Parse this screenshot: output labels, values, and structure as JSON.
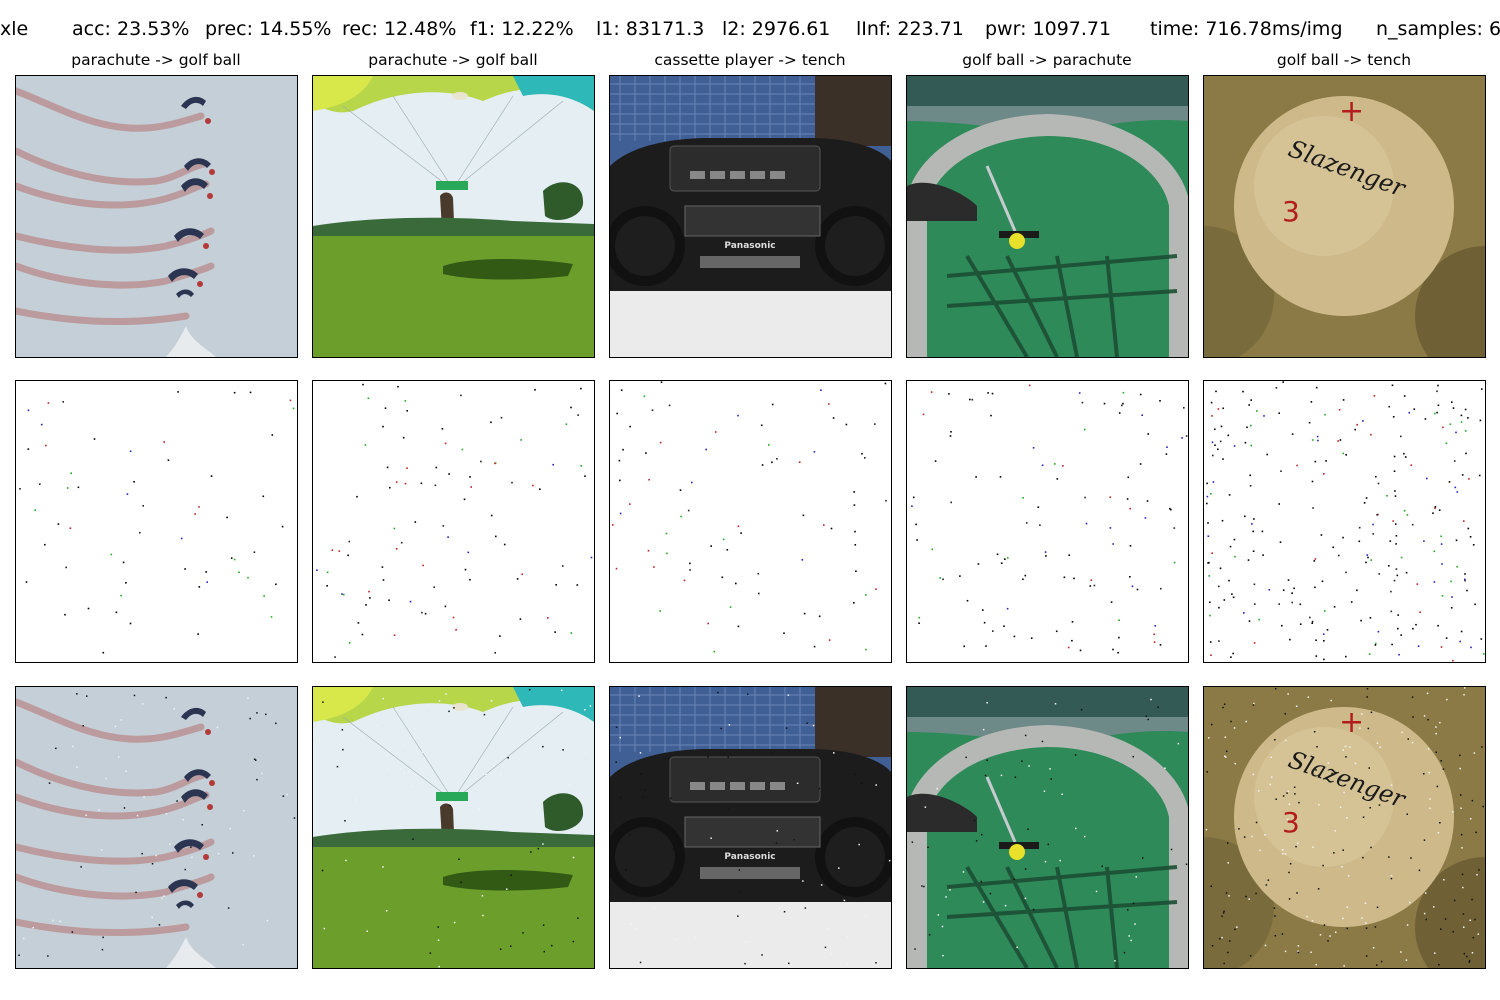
{
  "metrics": {
    "method": "xle",
    "acc": "acc: 23.53%",
    "prec": "prec: 14.55%",
    "rec": "rec: 12.48%",
    "f1": "f1: 12.22%",
    "l1": "l1: 83171.3",
    "l2": "l2: 2976.61",
    "linf": "lInf: 223.71",
    "pwr": "pwr: 1097.71",
    "time": "time: 716.78ms/img",
    "n_samples": "n_samples: 6"
  },
  "columns": [
    {
      "title": "parachute -> golf ball",
      "scene": "skydivers with smoke trails"
    },
    {
      "title": "parachute -> golf ball",
      "scene": "parachutist landing on grass field"
    },
    {
      "title": "cassette player -> tench",
      "scene": "Panasonic boombox"
    },
    {
      "title": "golf ball -> parachute",
      "scene": "yellow golf ball on green mini-golf turf"
    },
    {
      "title": "golf ball -> tench",
      "scene": "Slazenger golf ball close-up"
    }
  ],
  "logo_text": {
    "boombox_brand": "Panasonic",
    "golfball_brand": "Slazenger",
    "golfball_number": "3"
  },
  "rows": [
    "original",
    "perturbation",
    "adversarial"
  ],
  "colors": {
    "sky": "#c6d0d8",
    "grass": "#6c9e2c",
    "turf": "#2f8a5a",
    "ball": "#cdb98a",
    "smoke": "#b4716f"
  }
}
